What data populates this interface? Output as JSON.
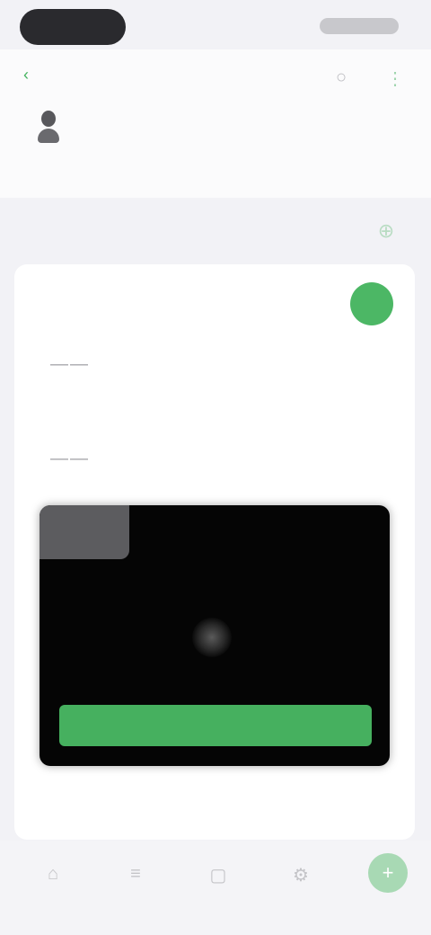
{
  "status_bar": {
    "time": "",
    "indicators": ""
  },
  "header": {
    "back_icon": "chevron-left-icon",
    "back_label": "",
    "title": "",
    "subtitle": "",
    "action_icons": [
      "search-icon",
      "more-icon"
    ],
    "accent_color": "#43b35e"
  },
  "profile": {
    "icon": "person-icon",
    "caption": ""
  },
  "section": {
    "title": "",
    "action_icon": "add-icon"
  },
  "card": {
    "caption_line1": "",
    "caption_line2": "",
    "toggle_color": "#4cb765",
    "rows": [
      {
        "icon": "phone-icon",
        "title": "",
        "subtitle": ""
      },
      {
        "icon": "phone-icon",
        "title": "",
        "subtitle": ""
      }
    ],
    "video": {
      "button_label": "",
      "button_color": "#46b05f",
      "play_icon": "play-icon"
    },
    "footnote": ""
  },
  "bottom_bar": {
    "tabs": [
      {
        "icon": "home-icon",
        "label": ""
      },
      {
        "icon": "list-icon",
        "label": ""
      },
      {
        "icon": "calendar-icon",
        "label": ""
      },
      {
        "icon": "settings-icon",
        "label": ""
      }
    ],
    "fab_icon": "plus-icon"
  }
}
